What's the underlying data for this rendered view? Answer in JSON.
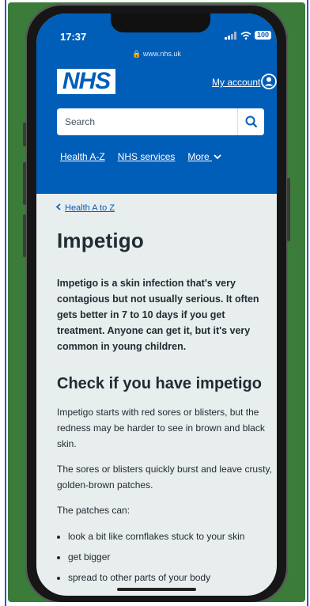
{
  "status": {
    "time": "17:37",
    "battery": "100"
  },
  "browser": {
    "url": "www.nhs.uk"
  },
  "header": {
    "logo": "NHS",
    "account_label": "My account",
    "search_placeholder": "Search",
    "nav": [
      "Health A-Z",
      "NHS services",
      "More"
    ]
  },
  "main": {
    "breadcrumb": "Health A to Z",
    "title": "Impetigo",
    "lede": "Impetigo is a skin infection that's very contagious but not usually serious. It often gets better in 7 to 10 days if you get treatment. Anyone can get it, but it's very common in young children.",
    "section_title": "Check if you have impetigo",
    "paragraphs": [
      "Impetigo starts with red sores or blisters, but the redness may be harder to see in brown and black skin.",
      "The sores or blisters quickly burst and leave crusty, golden-brown patches.",
      "The patches can:"
    ],
    "bullets": [
      "look a bit like cornflakes stuck to your skin",
      "get bigger",
      "spread to other parts of your body"
    ]
  },
  "colors": {
    "nhs_blue": "#005eb8",
    "background": "#e8edee",
    "text": "#212b32"
  },
  "icons": [
    "signal-icon",
    "wifi-icon",
    "battery-icon",
    "user-circle-icon",
    "search-icon",
    "chevron-down-icon",
    "chevron-left-icon"
  ]
}
